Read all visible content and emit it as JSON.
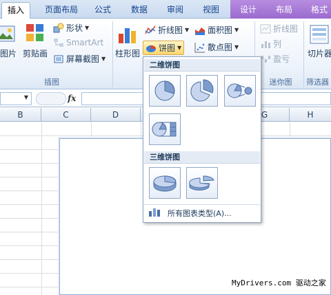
{
  "tabs": [
    {
      "label": "插入",
      "active": true
    },
    {
      "label": "页面布局"
    },
    {
      "label": "公式"
    },
    {
      "label": "数据"
    },
    {
      "label": "审阅"
    },
    {
      "label": "视图"
    },
    {
      "label": "设计",
      "contextual": true
    },
    {
      "label": "布局",
      "contextual": true
    },
    {
      "label": "格式",
      "contextual": true
    }
  ],
  "ribbon": {
    "picture_label": "图片",
    "clipart_label": "剪贴画",
    "shapes_label": "形状",
    "smartart_label": "SmartArt",
    "screenshot_label": "屏幕截图",
    "illustrations_group": "插图",
    "column_label": "柱形图",
    "line_label": "折线图",
    "area_label": "面积图",
    "pie_label": "饼图",
    "scatter_label": "散点图",
    "spark_line_label": "折线图",
    "spark_column_label": "列",
    "spark_winloss_label": "盈亏",
    "sparklines_group": "迷你图",
    "slicer_label": "切片器",
    "filter_group": "筛选器"
  },
  "formula_bar": {
    "fx": "fx"
  },
  "columns": [
    "B",
    "C",
    "D",
    "G",
    "H"
  ],
  "pie_menu": {
    "section_2d": "二维饼图",
    "section_3d": "三维饼图",
    "all_types": "所有图表类型(A)..."
  },
  "watermark": "MyDrivers.com 驱动之家",
  "colors": {
    "accent": "#9b6bcf",
    "ribbon_border": "#a3bde3",
    "pie_highlight": "#ffd66e"
  }
}
